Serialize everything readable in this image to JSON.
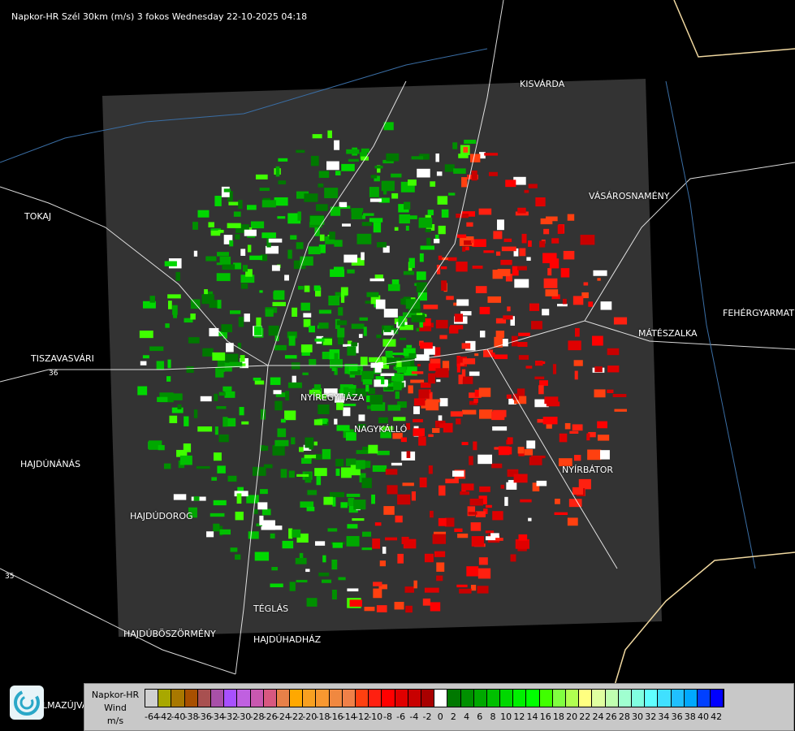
{
  "title": "Napkor-HR Szél 30km (m/s) 3 fokos Wednesday 22-10-2025 04:18",
  "cities": [
    {
      "name": "KISVÁRDA",
      "pos": "a"
    },
    {
      "name": "VÁSÁROSNAMÉNY"
    },
    {
      "name": "TOKAJ"
    },
    {
      "name": "TISZAVASVÁRI"
    },
    {
      "name": "NYÍREGYHÁZA"
    },
    {
      "name": "MÁTÉSZALKA"
    },
    {
      "name": "FEHÉRGYARMAT"
    },
    {
      "name": "NAGYKÁLLÓ"
    },
    {
      "name": "NYÍRBÁTOR"
    },
    {
      "name": "HAJDÚNÁNÁS"
    },
    {
      "name": "HAJDÚDOROG"
    },
    {
      "name": "TÉGLÁS"
    },
    {
      "name": "HAJDÚBÖSZÖRMÉNY"
    },
    {
      "name": "HAJDÚHADHÁZ"
    },
    {
      "name": "LMAZÚJVÁR"
    }
  ],
  "roads": [
    "36",
    "35"
  ],
  "legend": {
    "line1": "Napkor-HR",
    "line2": "Wind",
    "line3": "m/s",
    "colors": [
      "#d0d0d0",
      "#a8a800",
      "#a87800",
      "#a85000",
      "#a85050",
      "#a850a8",
      "#a850ff",
      "#c060e0",
      "#c858b0",
      "#d85880",
      "#e88048",
      "#ffa800",
      "#f8a020",
      "#f89830",
      "#f08840",
      "#f08048",
      "#ff4010",
      "#ff2010",
      "#ff0000",
      "#e00000",
      "#c80000",
      "#a80000",
      "#ffffff",
      "#007800",
      "#009000",
      "#00a800",
      "#00c000",
      "#00d800",
      "#00f000",
      "#00ff00",
      "#40ff00",
      "#80ff40",
      "#b0ff50",
      "#ffff80",
      "#e0ffa0",
      "#c0ffb0",
      "#a0ffd0",
      "#80ffe0",
      "#60ffff",
      "#40e0ff",
      "#20c0ff",
      "#00a8ff",
      "#0040ff",
      "#0000ff"
    ],
    "labels": [
      "-64",
      "-42",
      "-40",
      "-38",
      "-36",
      "-34",
      "-32",
      "-30",
      "-28",
      "-26",
      "-24",
      "-22",
      "-20",
      "-18",
      "-16",
      "-14",
      "-12",
      "-10",
      "-8",
      "-6",
      "-4",
      "-2",
      "0",
      "2",
      "4",
      "6",
      "8",
      "10",
      "12",
      "14",
      "16",
      "18",
      "20",
      "22",
      "24",
      "26",
      "28",
      "30",
      "32",
      "34",
      "36",
      "38",
      "40",
      "42"
    ]
  }
}
